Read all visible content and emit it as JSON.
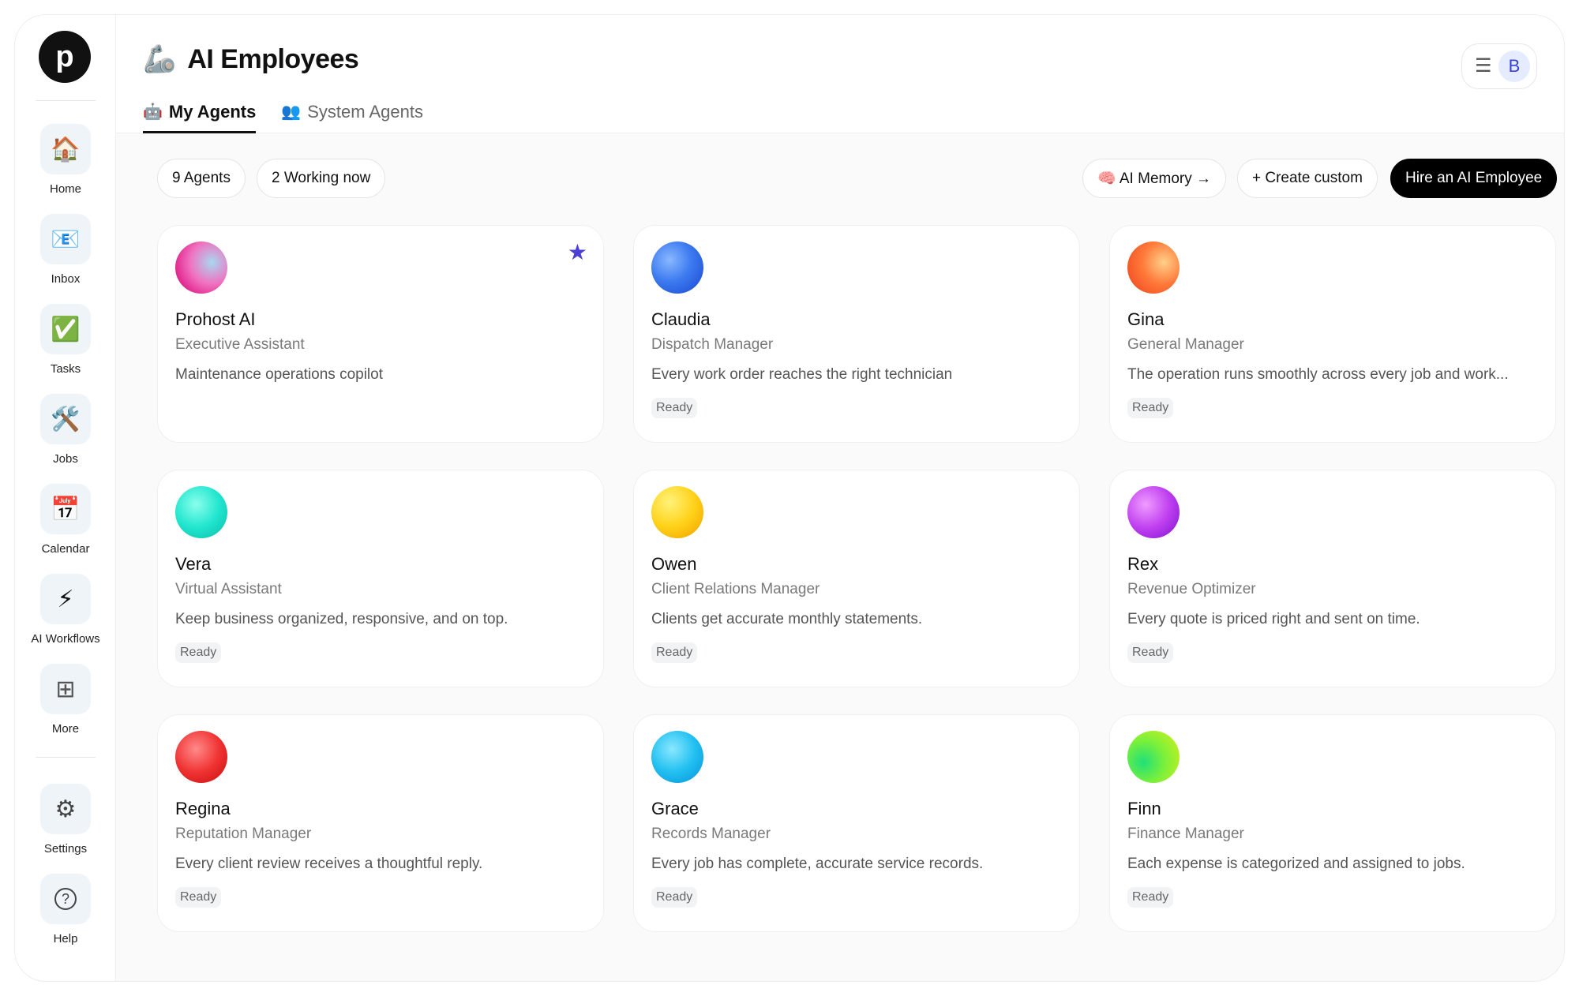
{
  "sidebar": {
    "logo": "p",
    "items": [
      {
        "label": "Home",
        "icon": "🏠",
        "icon_name": "house-icon"
      },
      {
        "label": "Inbox",
        "icon": "📧",
        "icon_name": "inbox-icon"
      },
      {
        "label": "Tasks",
        "icon": "✅",
        "icon_name": "checkmark-icon"
      },
      {
        "label": "Jobs",
        "icon": "🛠️",
        "icon_name": "tools-icon"
      },
      {
        "label": "Calendar",
        "icon": "📅",
        "icon_name": "calendar-icon"
      },
      {
        "label": "AI Workflows",
        "icon": "⚡",
        "icon_name": "lightning-icon"
      },
      {
        "label": "More",
        "icon": "⊞",
        "icon_name": "grid-icon"
      }
    ],
    "bottom_items": [
      {
        "label": "Settings",
        "icon": "⚙",
        "icon_name": "gear-icon"
      },
      {
        "label": "Help",
        "icon": "?",
        "icon_name": "help-icon"
      }
    ]
  },
  "header": {
    "title": "AI Employees",
    "title_emoji": "🦾",
    "avatar_letter": "B",
    "menu_icon": "☰"
  },
  "tabs": [
    {
      "label": "My Agents",
      "emoji": "🤖",
      "active": true
    },
    {
      "label": "System Agents",
      "emoji": "👥",
      "active": false
    }
  ],
  "toolbar": {
    "agents_count": "9 Agents",
    "working_now": "2 Working now",
    "memory_label": "🧠 AI Memory →",
    "create_label": "+ Create custom",
    "hire_label": "Hire an AI Employee"
  },
  "agents": [
    {
      "name": "Prohost AI",
      "role": "Executive Assistant",
      "desc": "Maintenance operations copilot",
      "status": "",
      "starred": true,
      "orb": "radial-gradient(circle at 70% 40%, #a8d8f0 0%, #f072c0 45%, #e0208a 80%)"
    },
    {
      "name": "Claudia",
      "role": "Dispatch Manager",
      "desc": "Every work order reaches the right technician",
      "status": "Ready",
      "orb": "radial-gradient(circle at 35% 35%, #8ab8ff 0%, #3d7bf0 45%, #1f4fd6 90%)"
    },
    {
      "name": "Gina",
      "role": "General Manager",
      "desc": "The operation runs smoothly across every job and work...",
      "status": "Ready",
      "orb": "radial-gradient(circle at 70% 40%, #ffd08a 0%, #ff7a3a 45%, #f04a20 90%)"
    },
    {
      "name": "Vera",
      "role": "Virtual Assistant",
      "desc": "Keep business organized, responsive, and on top.",
      "status": "Ready",
      "orb": "radial-gradient(circle at 40% 35%, #8affec 0%, #22e6cf 50%, #0cc4b0 90%)"
    },
    {
      "name": "Owen",
      "role": "Client Relations Manager",
      "desc": "Clients get accurate monthly statements.",
      "status": "Ready",
      "orb": "radial-gradient(circle at 35% 30%, #fff27a 0%, #ffd21a 50%, #f2a800 90%)"
    },
    {
      "name": "Rex",
      "role": "Revenue Optimizer",
      "desc": "Every quote is priced right and sent on time.",
      "status": "Ready",
      "orb": "radial-gradient(circle at 35% 35%, #f09cff 0%, #c040f0 50%, #8a1ad6 90%)"
    },
    {
      "name": "Regina",
      "role": "Reputation Manager",
      "desc": "Every client review receives a thoughtful reply.",
      "status": "Ready",
      "orb": "radial-gradient(circle at 40% 35%, #ff8a8a 0%, #f03434 50%, #d01414 90%)"
    },
    {
      "name": "Grace",
      "role": "Records Manager",
      "desc": "Every job has complete, accurate service records.",
      "status": "Ready",
      "orb": "radial-gradient(circle at 40% 35%, #8ae8ff 0%, #22c0f0 50%, #0a9ae0 90%)"
    },
    {
      "name": "Finn",
      "role": "Finance Manager",
      "desc": "Each expense is categorized and assigned to jobs.",
      "status": "Ready",
      "orb": "radial-gradient(circle at 30% 60%, #20e07a 0%, #7af03a 45%, #c8f020 90%)"
    }
  ]
}
